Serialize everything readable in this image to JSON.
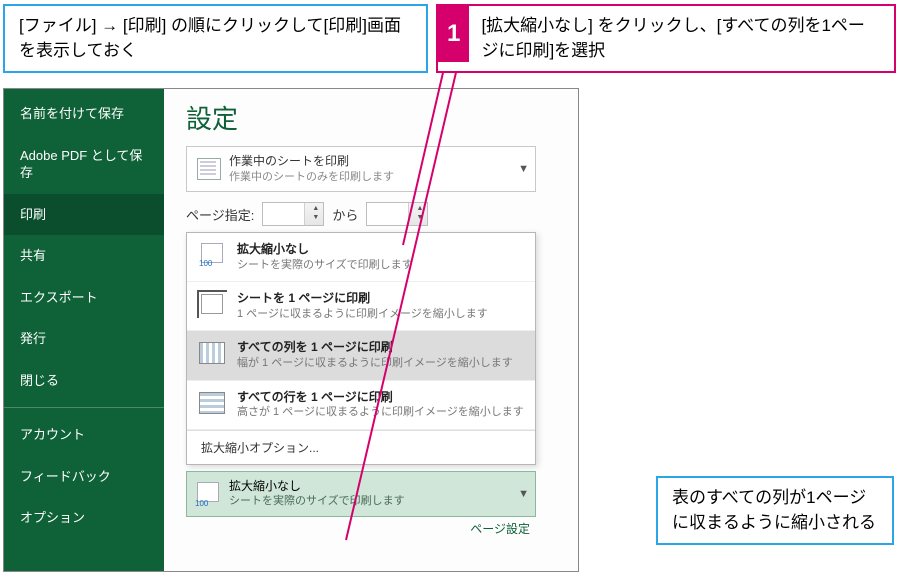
{
  "callouts": {
    "left": "[ファイル] → [印刷] の順にクリックして[印刷]画面を表示しておく",
    "right_badge": "1",
    "right": "[拡大縮小なし] をクリックし、[すべての列を1ページに印刷]を選択",
    "bottom": "表のすべての列が1ページに収まるように縮小される"
  },
  "sidebar": {
    "items": [
      "名前を付けて保存",
      "Adobe PDF として保存",
      "印刷",
      "共有",
      "エクスポート",
      "発行",
      "閉じる",
      "アカウント",
      "フィードバック",
      "オプション"
    ],
    "active_index": 2
  },
  "main": {
    "title": "設定",
    "sheet": {
      "t1": "作業中のシートを印刷",
      "t2": "作業中のシートのみを印刷します"
    },
    "page_label": "ページ指定:",
    "page_to": "から",
    "options": [
      {
        "t1": "拡大縮小なし",
        "t2": "シートを実際のサイズで印刷します",
        "icon": "ic-100"
      },
      {
        "t1": "シートを 1 ページに印刷",
        "t2": "1 ページに収まるように印刷イメージを縮小します",
        "icon": "ic-crop"
      },
      {
        "t1": "すべての列を 1 ページに印刷",
        "t2": "幅が 1 ページに収まるように印刷イメージを縮小します",
        "icon": "ic-cols"
      },
      {
        "t1": "すべての行を 1 ページに印刷",
        "t2": "高さが 1 ページに収まるように印刷イメージを縮小します",
        "icon": "ic-rows"
      }
    ],
    "selected_index": 2,
    "extra": "拡大縮小オプション...",
    "current": {
      "t1": "拡大縮小なし",
      "t2": "シートを実際のサイズで印刷します"
    },
    "page_setup": "ページ設定"
  }
}
